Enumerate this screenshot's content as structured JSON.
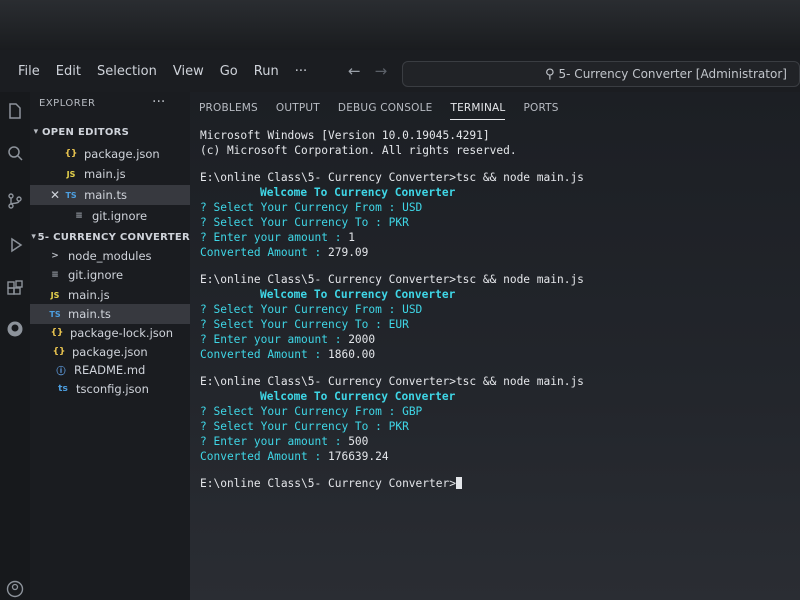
{
  "menu": [
    "File",
    "Edit",
    "Selection",
    "View",
    "Go",
    "Run",
    "···"
  ],
  "nav": {
    "back": "←",
    "forward": "→"
  },
  "command_center": {
    "icon": "search-icon",
    "title": "5- Currency Converter [Administrator]"
  },
  "sidebar": {
    "header": "EXPLORER",
    "more": "···",
    "open_editors": {
      "label": "OPEN EDITORS",
      "items": [
        {
          "name": "package.json",
          "icon": "{}"
        },
        {
          "name": "main.js",
          "icon": "JS"
        },
        {
          "name": "main.ts",
          "icon": "TS"
        },
        {
          "name": "git.ignore",
          "icon": "≡"
        }
      ]
    },
    "project": {
      "label": "5- CURRENCY CONVERTER",
      "items": [
        {
          "name": "node_modules",
          "icon": ">"
        },
        {
          "name": "git.ignore",
          "icon": "≡"
        },
        {
          "name": "main.js",
          "icon": "JS"
        },
        {
          "name": "main.ts",
          "icon": "TS"
        },
        {
          "name": "package-lock.json",
          "icon": "{}"
        },
        {
          "name": "package.json",
          "icon": "{}"
        },
        {
          "name": "README.md",
          "icon": "ⓘ"
        },
        {
          "name": "tsconfig.json",
          "icon": "ts"
        }
      ]
    }
  },
  "panel_tabs": [
    "PROBLEMS",
    "OUTPUT",
    "DEBUG CONSOLE",
    "TERMINAL",
    "PORTS"
  ],
  "terminal": {
    "header1": "Microsoft Windows [Version 10.0.19045.4291]",
    "header2": "(c) Microsoft Corporation. All rights reserved.",
    "runs": [
      {
        "prompt": "E:\\online Class\\5- Currency Converter>tsc && node main.js",
        "welcome": "Welcome To Currency Converter",
        "q_from_label": "? Select Your Currency From : ",
        "q_from_value": "USD",
        "q_to_label": "? Select Your Currency To : ",
        "q_to_value": "PKR",
        "q_amount_label": "? Enter your amount : ",
        "q_amount_value": "1",
        "result_label": "Converted Amount : ",
        "result_value": "279.09"
      },
      {
        "prompt": "E:\\online Class\\5- Currency Converter>tsc && node main.js",
        "welcome": "Welcome To Currency Converter",
        "q_from_label": "? Select Your Currency From : ",
        "q_from_value": "USD",
        "q_to_label": "? Select Your Currency To : ",
        "q_to_value": "EUR",
        "q_amount_label": "? Enter your amount : ",
        "q_amount_value": "2000",
        "result_label": "Converted Amount : ",
        "result_value": "1860.00"
      },
      {
        "prompt": "E:\\online Class\\5- Currency Converter>tsc && node main.js",
        "welcome": "Welcome To Currency Converter",
        "q_from_label": "? Select Your Currency From : ",
        "q_from_value": "GBP",
        "q_to_label": "? Select Your Currency To : ",
        "q_to_value": "PKR",
        "q_amount_label": "? Enter your amount : ",
        "q_amount_value": "500",
        "result_label": "Converted Amount : ",
        "result_value": "176639.24"
      }
    ],
    "final_prompt": "E:\\online Class\\5- Currency Converter>"
  },
  "colors": {
    "accent_cyan": "#3fd6e6",
    "terminal_text": "#e4e6ea",
    "panel_bg": "#1c1f24"
  }
}
